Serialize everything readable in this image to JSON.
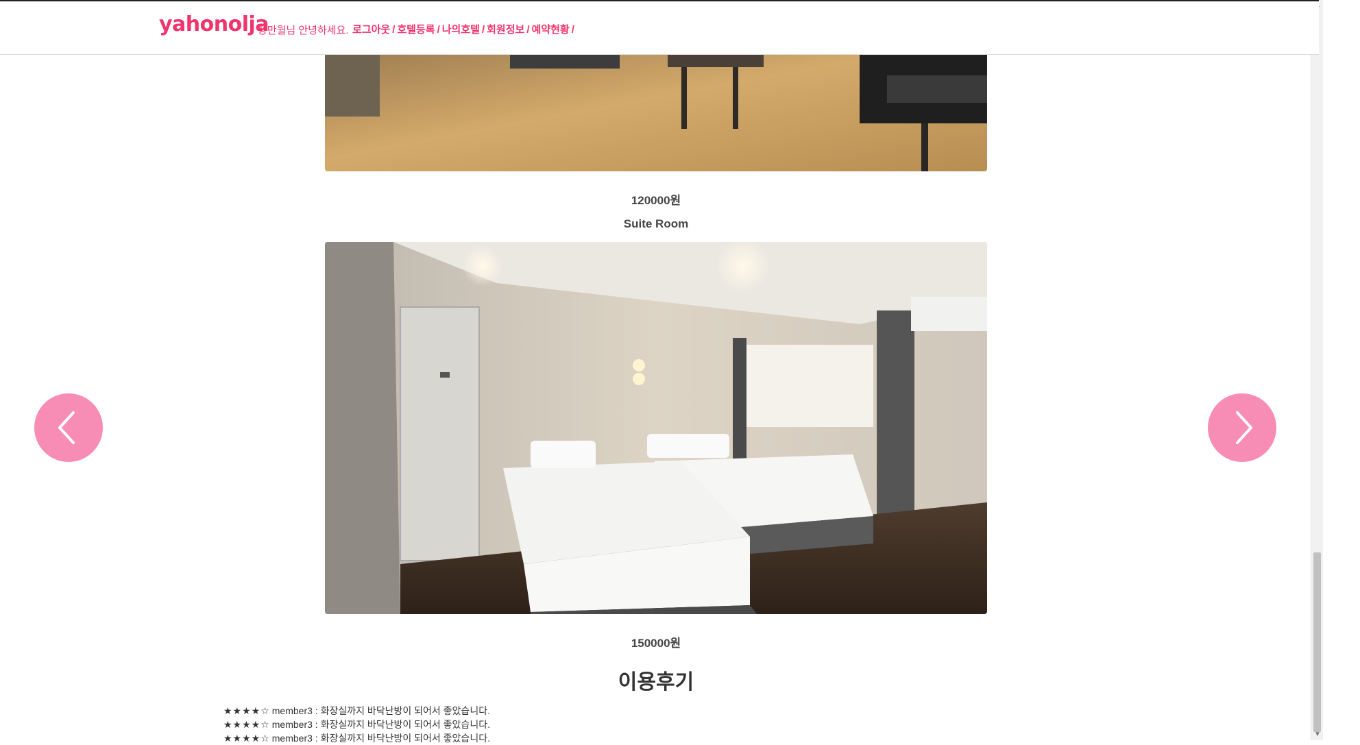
{
  "header": {
    "logo": "yahonolja",
    "greeting": "장만월님 안녕하세요.",
    "nav": [
      {
        "label": "로그아웃"
      },
      {
        "label": "호텔등록"
      },
      {
        "label": "나의호텔"
      },
      {
        "label": "회원정보"
      },
      {
        "label": "예약현황"
      }
    ],
    "separator": "/"
  },
  "rooms": [
    {
      "price": "120000원"
    },
    {
      "name": "Suite Room",
      "price": "150000원"
    }
  ],
  "reviews": {
    "title": "이용후기",
    "items": [
      {
        "stars": "★★★★☆",
        "text": "member3 : 화장실까지 바닥난방이 되어서 좋았습니다."
      },
      {
        "stars": "★★★★☆",
        "text": "member3 : 화장실까지 바닥난방이 되어서 좋았습니다."
      },
      {
        "stars": "★★★★☆",
        "text": "member3 : 화장실까지 바닥난방이 되어서 좋았습니다."
      }
    ]
  },
  "carousel": {
    "prev_icon": "chevron-left-icon",
    "next_icon": "chevron-right-icon",
    "button_color": "#f78cb4"
  },
  "colors": {
    "brand": "#f0346e"
  }
}
